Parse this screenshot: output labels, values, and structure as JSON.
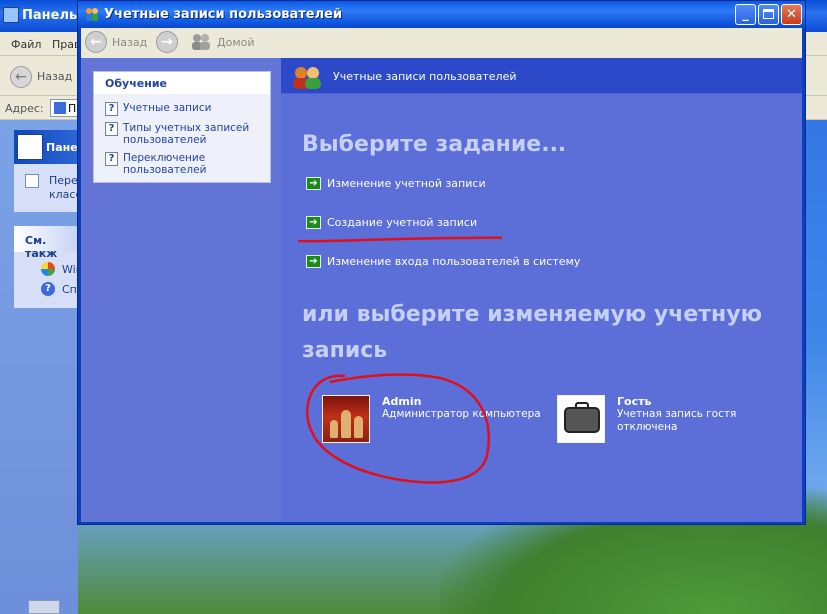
{
  "background_window": {
    "title": "Панель у",
    "menu": [
      "Файл",
      "Прав"
    ],
    "back_label": "Назад",
    "address_label": "Адрес:",
    "address_value": "Па",
    "task_panel_title": "Панел",
    "task_panel_links": [
      "Переі",
      "класс"
    ],
    "see_also_title": "См. такж",
    "see_also_links": [
      "Windo",
      "Справ"
    ]
  },
  "window": {
    "title": "Учетные записи пользователей",
    "toolbar": {
      "back_label": "Назад",
      "home_label": "Домой"
    }
  },
  "learn": {
    "title": "Обучение",
    "links": [
      {
        "label": "Учетные записи"
      },
      {
        "label": "Типы учетных записей пользователей"
      },
      {
        "label": "Переключение пользователей"
      }
    ]
  },
  "main": {
    "header_title": "Учетные записи пользователей",
    "task_heading": "Выберите задание...",
    "tasks": [
      {
        "label": "Изменение учетной записи"
      },
      {
        "label": "Создание учетной записи"
      },
      {
        "label": "Изменение входа пользователей в систему"
      }
    ],
    "pick_heading": "или выберите изменяемую учетную запись",
    "accounts": [
      {
        "name": "Admin",
        "description": "Администратор компьютера"
      },
      {
        "name": "Гость",
        "description": "Учетная запись гостя отключена"
      }
    ]
  },
  "annotation_color": "#e0101a"
}
